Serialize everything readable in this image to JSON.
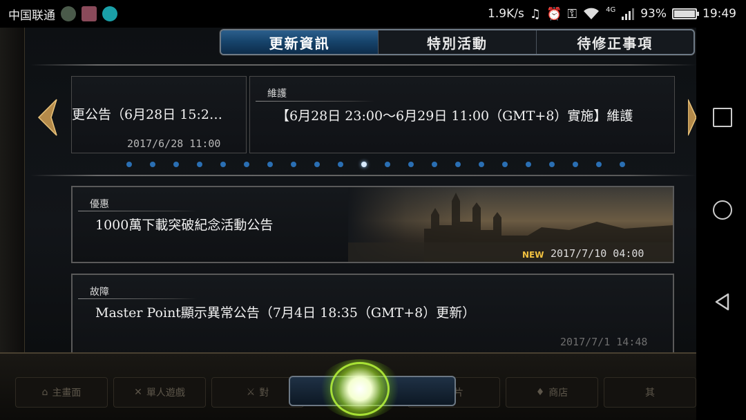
{
  "status_bar": {
    "carrier": "中国联通",
    "net_speed": "1.9K/s",
    "network_type": "4G",
    "battery": "93%",
    "battery_level": 0.93,
    "time": "19:49"
  },
  "tabs": [
    {
      "label": "更新資訊",
      "active": true
    },
    {
      "label": "特別活動",
      "active": false
    },
    {
      "label": "待修正事項",
      "active": false
    }
  ],
  "carousel": {
    "left_card": {
      "title": "更公告（6月28日 15:2…",
      "date": "2017/6/28 11:00"
    },
    "right_card": {
      "tag": "維護",
      "title": "【6月28日 23:00〜6月29日 11:00（GMT+8）實施】維護"
    },
    "page_count": 22,
    "active_page": 10
  },
  "news": [
    {
      "tag": "優惠",
      "title": "1000萬下載突破紀念活動公告",
      "badge": "NEW",
      "date": "2017/7/10 04:00"
    },
    {
      "tag": "故障",
      "title": "Master Point顯示異常公告（7月4日 18:35（GMT+8）更新）",
      "date": "2017/7/1 14:48"
    }
  ],
  "bottom_menu": [
    "主畫面",
    "單人遊戲",
    "對",
    "",
    "卡片",
    "商店",
    "其"
  ],
  "colors": {
    "tab_active": "#17456d",
    "dot": "#2a6fb3",
    "badge_new": "#f0c040"
  },
  "icons": {
    "headset": "headset-icon",
    "alarm": "alarm-icon",
    "key": "key-icon",
    "wifi": "wifi-icon",
    "signal": "signal-icon"
  }
}
